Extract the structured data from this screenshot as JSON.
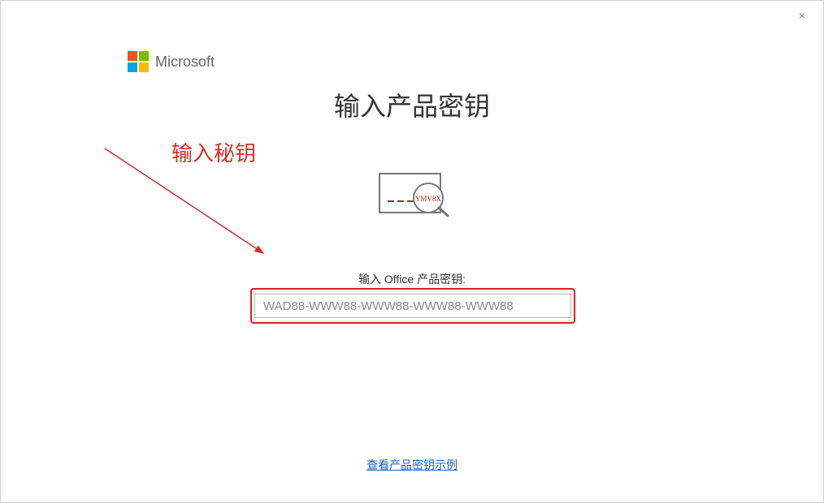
{
  "window": {
    "close_glyph": "×"
  },
  "logo": {
    "text": "Microsoft"
  },
  "title": "输入产品密钥",
  "annotation": "输入秘钥",
  "illustration": {
    "key_sample": "YMV8X"
  },
  "input": {
    "label": "输入 Office 产品密钥:",
    "placeholder": "WAD88-WWW88-WWW88-WWW88-WWW88"
  },
  "link": {
    "example": "查看产品密钥示例"
  }
}
